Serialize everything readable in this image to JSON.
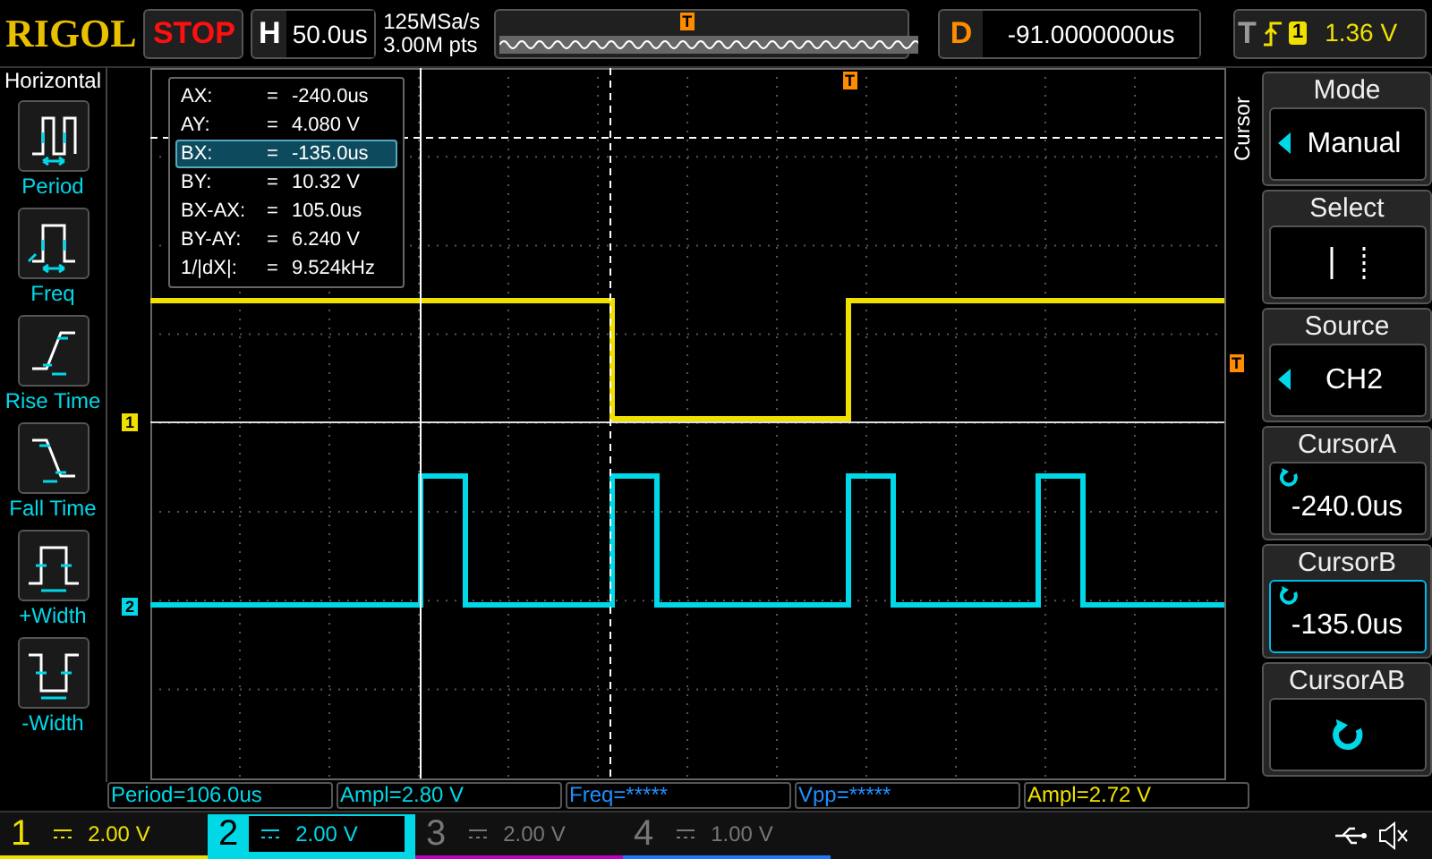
{
  "top_bar": {
    "logo": "RIGOL",
    "run_state": {
      "text": "STOP",
      "running": false
    },
    "horizontal": {
      "label": "H",
      "value": "50.0us"
    },
    "sample_rate": "125MSa/s",
    "memory_depth": "3.00M pts",
    "delay": {
      "label": "D",
      "value": "-91.0000000us"
    },
    "trigger": {
      "label": "T",
      "source": "1",
      "level": "1.36 V"
    },
    "memory_marker": "T"
  },
  "left_menu": {
    "title": "Horizontal",
    "items": [
      {
        "label": "Period",
        "kind": "period"
      },
      {
        "label": "Freq",
        "kind": "freq"
      },
      {
        "label": "Rise Time",
        "kind": "rise"
      },
      {
        "label": "Fall Time",
        "kind": "fall"
      },
      {
        "label": "+Width",
        "kind": "pwidth"
      },
      {
        "label": "-Width",
        "kind": "nwidth"
      }
    ]
  },
  "grid": {
    "channel_markers": [
      {
        "label": "1",
        "color": "#f0e000"
      },
      {
        "label": "2",
        "color": "#00d8e8"
      }
    ],
    "trigger_marker_top": "T",
    "trigger_marker_right": "T",
    "readout": [
      {
        "label": "AX:",
        "eq": "=",
        "value": "-240.0us",
        "selected": false
      },
      {
        "label": "AY:",
        "eq": "=",
        "value": "4.080 V",
        "selected": false
      },
      {
        "label": "BX:",
        "eq": "=",
        "value": "-135.0us",
        "selected": true
      },
      {
        "label": "BY:",
        "eq": "=",
        "value": "10.32 V",
        "selected": false
      },
      {
        "label": "BX-AX:",
        "eq": "=",
        "value": "105.0us",
        "selected": false
      },
      {
        "label": "BY-AY:",
        "eq": "=",
        "value": "6.240 V",
        "selected": false
      },
      {
        "label": "1/|dX|:",
        "eq": "=",
        "value": "9.524kHz",
        "selected": false
      }
    ]
  },
  "right_menu": {
    "title": "Cursor",
    "items": [
      {
        "title": "Mode",
        "kind": "list",
        "value": "Manual",
        "selected": false
      },
      {
        "title": "Select",
        "kind": "lines",
        "selected": false
      },
      {
        "title": "Source",
        "kind": "list",
        "value": "CH2",
        "selected": false
      },
      {
        "title": "CursorA",
        "kind": "knob",
        "value": "-240.0us",
        "selected": false
      },
      {
        "title": "CursorB",
        "kind": "knob",
        "value": "-135.0us",
        "selected": true
      },
      {
        "title": "CursorAB",
        "kind": "knob",
        "selected": false
      }
    ]
  },
  "measurements": [
    {
      "text": "Period=106.0us",
      "color": "#00d8e8"
    },
    {
      "text": "Ampl=2.80 V",
      "color": "#00d8e8"
    },
    {
      "text": "Freq=*****",
      "color": "#1e90ff"
    },
    {
      "text": "Vpp=*****",
      "color": "#1e90ff"
    },
    {
      "text": "Ampl=2.72 V",
      "color": "#f0e000"
    }
  ],
  "channels": [
    {
      "number": "1",
      "scale": "2.00 V",
      "color": "#f0e000",
      "on": true,
      "selected": false
    },
    {
      "number": "2",
      "scale": "2.00 V",
      "color": "#00d8e8",
      "on": true,
      "selected": true
    },
    {
      "number": "3",
      "scale": "2.00 V",
      "color": "#c000c0",
      "on": false,
      "selected": false
    },
    {
      "number": "4",
      "scale": "1.00 V",
      "color": "#1e78ff",
      "on": false,
      "selected": false
    }
  ]
}
